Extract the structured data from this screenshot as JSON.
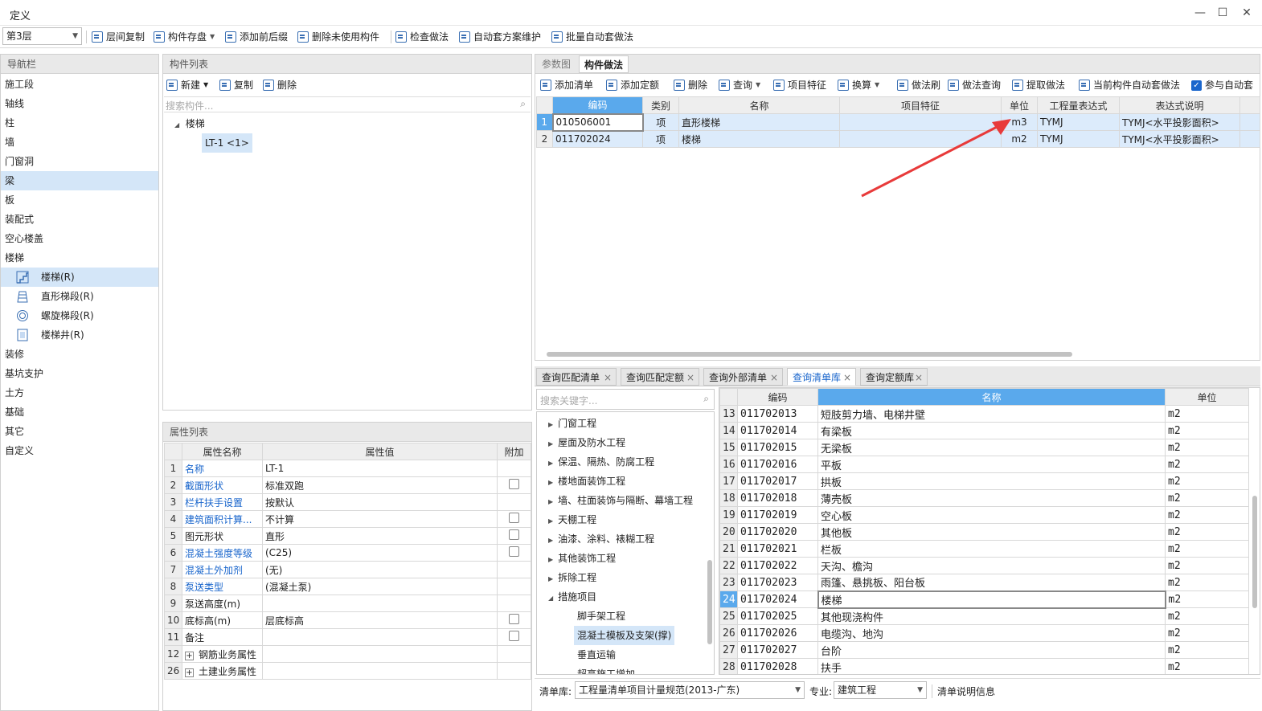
{
  "window": {
    "title": "定义"
  },
  "toolbar": {
    "floor": "第3层",
    "buttons": [
      "层间复制",
      "构件存盘",
      "添加前后缀",
      "删除未使用构件",
      "检查做法",
      "自动套方案维护",
      "批量自动套做法"
    ]
  },
  "nav": {
    "header": "导航栏",
    "items": [
      "施工段",
      "轴线",
      "柱",
      "墙",
      "门窗洞",
      "梁",
      "板",
      "装配式",
      "空心楼盖",
      "楼梯"
    ],
    "sub_items": [
      "楼梯(R)",
      "直形梯段(R)",
      "螺旋梯段(R)",
      "楼梯井(R)"
    ],
    "items_after": [
      "装修",
      "基坑支护",
      "土方",
      "基础",
      "其它",
      "自定义"
    ]
  },
  "components": {
    "header": "构件列表",
    "btn_new": "新建",
    "btn_copy": "复制",
    "btn_delete": "删除",
    "search_placeholder": "搜索构件...",
    "tree_root": "楼梯",
    "tree_child": "LT-1 <1>"
  },
  "props": {
    "header": "属性列表",
    "cols": [
      "属性名称",
      "属性值",
      "附加"
    ],
    "rows": [
      {
        "n": "1",
        "name": "名称",
        "val": "LT-1",
        "blue": true,
        "cb": false
      },
      {
        "n": "2",
        "name": "截面形状",
        "val": "标准双跑",
        "blue": true,
        "cb": true
      },
      {
        "n": "3",
        "name": "栏杆扶手设置",
        "val": "按默认",
        "blue": true,
        "cb": false
      },
      {
        "n": "4",
        "name": "建筑面积计算...",
        "val": "不计算",
        "blue": true,
        "cb": true
      },
      {
        "n": "5",
        "name": "图元形状",
        "val": "直形",
        "blue": false,
        "cb": true
      },
      {
        "n": "6",
        "name": "混凝土强度等级",
        "val": "(C25)",
        "blue": true,
        "cb": true
      },
      {
        "n": "7",
        "name": "混凝土外加剂",
        "val": "(无)",
        "blue": true,
        "cb": false
      },
      {
        "n": "8",
        "name": "泵送类型",
        "val": "(混凝土泵)",
        "blue": true,
        "cb": false
      },
      {
        "n": "9",
        "name": "泵送高度(m)",
        "val": "",
        "blue": false,
        "cb": false
      },
      {
        "n": "10",
        "name": "底标高(m)",
        "val": "层底标高",
        "blue": false,
        "cb": true
      },
      {
        "n": "11",
        "name": "备注",
        "val": "",
        "blue": false,
        "cb": true
      },
      {
        "n": "12",
        "name": "钢筋业务属性",
        "val": "",
        "blue": false,
        "cb": false,
        "plus": true
      },
      {
        "n": "26",
        "name": "土建业务属性",
        "val": "",
        "blue": false,
        "cb": false,
        "plus": true
      }
    ]
  },
  "method": {
    "tabs": [
      "参数图",
      "构件做法"
    ],
    "toolbar": [
      "添加清单",
      "添加定额",
      "删除",
      "查询",
      "项目特征",
      "换算",
      "做法刷",
      "做法查询",
      "提取做法",
      "当前构件自动套做法",
      "参与自动套"
    ],
    "cols": [
      "编码",
      "类别",
      "名称",
      "项目特征",
      "单位",
      "工程量表达式",
      "表达式说明"
    ],
    "rows": [
      {
        "n": "1",
        "code": "010506001",
        "type": "项",
        "name": "直形楼梯",
        "feat": "",
        "unit": "m3",
        "expr": "TYMJ",
        "desc": "TYMJ<水平投影面积>"
      },
      {
        "n": "2",
        "code": "011702024",
        "type": "项",
        "name": "楼梯",
        "feat": "",
        "unit": "m2",
        "expr": "TYMJ",
        "desc": "TYMJ<水平投影面积>"
      }
    ]
  },
  "query": {
    "tabs": [
      "查询匹配清单",
      "查询匹配定额",
      "查询外部清单",
      "查询清单库",
      "查询定额库"
    ],
    "search_placeholder": "搜索关键字...",
    "tree": [
      "门窗工程",
      "屋面及防水工程",
      "保温、隔热、防腐工程",
      "楼地面装饰工程",
      "墙、柱面装饰与隔断、幕墙工程",
      "天棚工程",
      "油漆、涂料、裱糊工程",
      "其他装饰工程",
      "拆除工程",
      "措施项目"
    ],
    "tree_children": [
      "脚手架工程",
      "混凝土模板及支架(撑)",
      "垂直运输",
      "超高施工增加"
    ],
    "cols": [
      "编码",
      "名称",
      "单位"
    ],
    "rows": [
      {
        "n": "13",
        "code": "011702013",
        "name": "短肢剪力墙、电梯井壁",
        "unit": "m2"
      },
      {
        "n": "14",
        "code": "011702014",
        "name": "有梁板",
        "unit": "m2"
      },
      {
        "n": "15",
        "code": "011702015",
        "name": "无梁板",
        "unit": "m2"
      },
      {
        "n": "16",
        "code": "011702016",
        "name": "平板",
        "unit": "m2"
      },
      {
        "n": "17",
        "code": "011702017",
        "name": "拱板",
        "unit": "m2"
      },
      {
        "n": "18",
        "code": "011702018",
        "name": "薄壳板",
        "unit": "m2"
      },
      {
        "n": "19",
        "code": "011702019",
        "name": "空心板",
        "unit": "m2"
      },
      {
        "n": "20",
        "code": "011702020",
        "name": "其他板",
        "unit": "m2"
      },
      {
        "n": "21",
        "code": "011702021",
        "name": "栏板",
        "unit": "m2"
      },
      {
        "n": "22",
        "code": "011702022",
        "name": "天沟、檐沟",
        "unit": "m2"
      },
      {
        "n": "23",
        "code": "011702023",
        "name": "雨篷、悬挑板、阳台板",
        "unit": "m2"
      },
      {
        "n": "24",
        "code": "011702024",
        "name": "楼梯",
        "unit": "m2"
      },
      {
        "n": "25",
        "code": "011702025",
        "name": "其他现浇构件",
        "unit": "m2"
      },
      {
        "n": "26",
        "code": "011702026",
        "name": "电缆沟、地沟",
        "unit": "m2"
      },
      {
        "n": "27",
        "code": "011702027",
        "name": "台阶",
        "unit": "m2"
      },
      {
        "n": "28",
        "code": "011702028",
        "name": "扶手",
        "unit": "m2"
      }
    ],
    "footer_lib_label": "清单库:",
    "footer_lib_value": "工程量清单项目计量规范(2013-广东)",
    "footer_spec_label": "专业:",
    "footer_spec_value": "建筑工程",
    "footer_info": "清单说明信息"
  },
  "colors": {
    "accent": "#1a66cc",
    "selected_bg": "#d4e6f8",
    "header_blue": "#5aa9ec",
    "arrow": "#e83a3a"
  }
}
